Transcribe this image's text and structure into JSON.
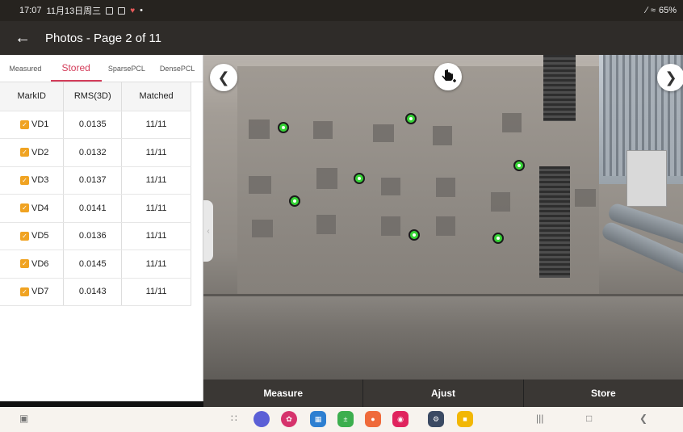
{
  "status_bar": {
    "time": "17:07",
    "date": "11月13日周三",
    "battery": "65%"
  },
  "header": {
    "title": "Photos - Page 2 of 11"
  },
  "tabs": [
    {
      "label": "Measured",
      "active": false
    },
    {
      "label": "Stored",
      "active": true
    },
    {
      "label": "SparsePCL",
      "active": false
    },
    {
      "label": "DensePCL",
      "active": false
    }
  ],
  "table": {
    "headers": [
      "MarkID",
      "RMS(3D)",
      "Matched"
    ],
    "rows": [
      {
        "id": "VD1",
        "rms": "0.0135",
        "matched": "11/11",
        "checked": true
      },
      {
        "id": "VD2",
        "rms": "0.0132",
        "matched": "11/11",
        "checked": true
      },
      {
        "id": "VD3",
        "rms": "0.0137",
        "matched": "11/11",
        "checked": true
      },
      {
        "id": "VD4",
        "rms": "0.0141",
        "matched": "11/11",
        "checked": true
      },
      {
        "id": "VD5",
        "rms": "0.0136",
        "matched": "11/11",
        "checked": true
      },
      {
        "id": "VD6",
        "rms": "0.0145",
        "matched": "11/11",
        "checked": true
      },
      {
        "id": "VD7",
        "rms": "0.0143",
        "matched": "11/11",
        "checked": true
      }
    ]
  },
  "actions": {
    "measure": "Measure",
    "adjust": "Ajust",
    "store": "Store"
  },
  "icons": {
    "back": "arrow-left-icon",
    "prev": "chevron-left-icon",
    "next": "chevron-right-icon",
    "hand": "hand-pointer-add-icon"
  },
  "colors": {
    "accent": "#d43d5a",
    "check": "#f0a322",
    "marker": "#36d436",
    "header_bg": "#2f2c29"
  }
}
